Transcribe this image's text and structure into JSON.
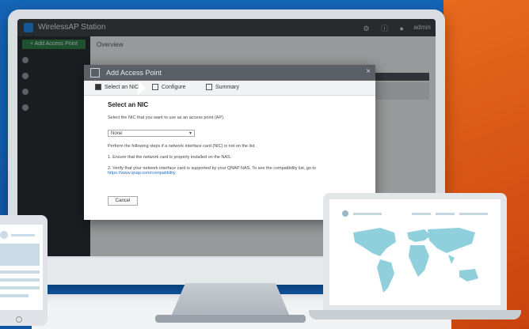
{
  "app": {
    "title": "WirelessAP Station",
    "admin": "admin",
    "top_icons": "⚙ ⓘ ●",
    "sidebar_button": "+ Add Access Point",
    "overview": "Overview"
  },
  "dialog": {
    "title": "Add Access Point",
    "close": "×",
    "steps": [
      "Select an NIC",
      "Configure",
      "Summary"
    ],
    "section_title": "Select an NIC",
    "prompt": "Select the NIC that you want to use as an access point (AP).",
    "select_value": "None",
    "select_arrow": "▾",
    "instructions_intro": "Perform the following steps if a network interface card (NIC) is not on the list.",
    "step_1": "1. Ensure that the network card is properly installed on the NAS.",
    "step_2_prefix": "2. Verify that your network interface card is supported by your QNAP NAS. To see the compatibility list, go to ",
    "step_2_link": "https://www.qnap.com/compatibility",
    "cancel": "Cancel"
  },
  "colors": {
    "accent": "#1e88e5",
    "background": "#d4470f",
    "panel": "#1565b8"
  }
}
